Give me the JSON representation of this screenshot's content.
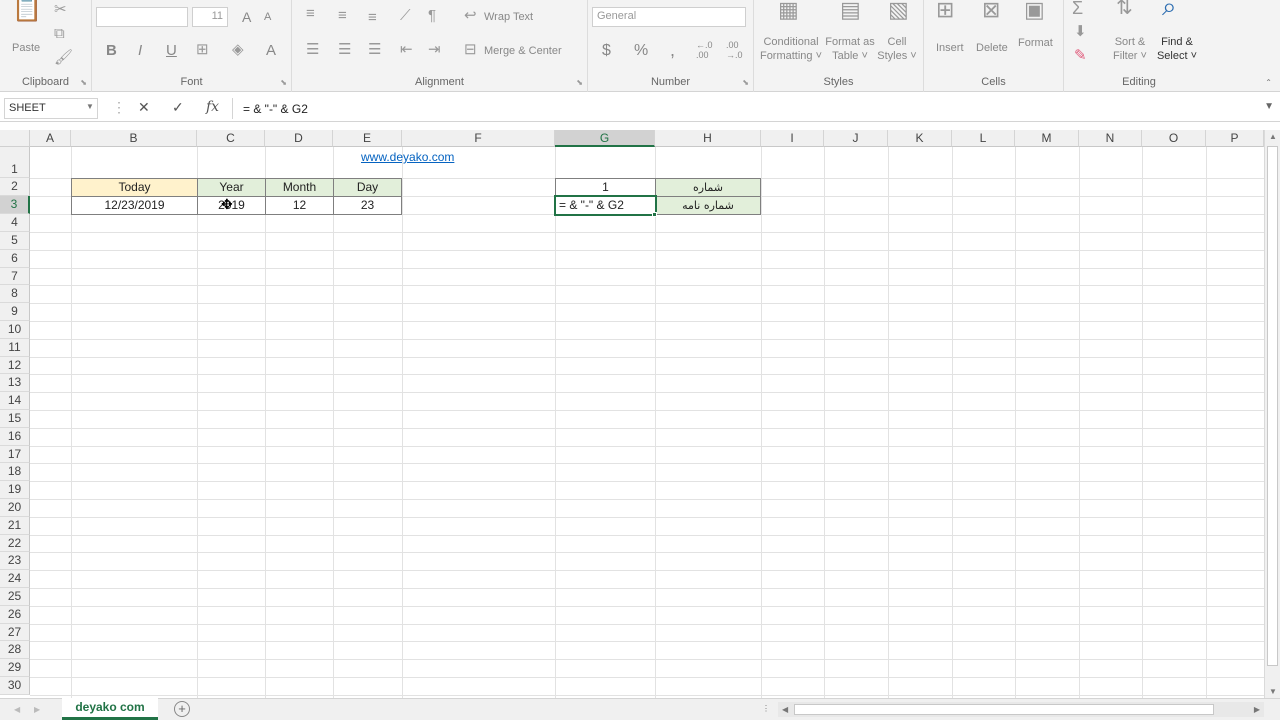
{
  "ribbon": {
    "clipboard": {
      "label": "Clipboard",
      "paste": "Paste"
    },
    "font": {
      "label": "Font",
      "size": "11",
      "bold": "B",
      "italic": "I",
      "underline": "U",
      "font_color": "A",
      "grow": "A",
      "shrink": "A"
    },
    "alignment": {
      "label": "Alignment",
      "wrap_text": "Wrap Text",
      "merge_center": "Merge & Center"
    },
    "number": {
      "label": "Number",
      "format": "General",
      "currency": "$",
      "percent": "%",
      "comma": ",",
      "inc_decimal": "←.0\n.00",
      "dec_decimal": ".00\n→.0"
    },
    "styles": {
      "label": "Styles",
      "conditional": "Conditional\nFormatting ˅",
      "format_table": "Format as\nTable ˅",
      "cell_styles": "Cell\nStyles ˅"
    },
    "cells": {
      "label": "Cells",
      "insert": "Insert",
      "delete": "Delete",
      "format": "Format"
    },
    "editing": {
      "label": "Editing",
      "sort_filter": "Sort &\nFilter ˅",
      "find_select": "Find &\nSelect ˅"
    }
  },
  "formula_bar": {
    "name_box": "SHEET",
    "formula": "= & \"-\" & G2",
    "cancel": "✕",
    "enter": "✓",
    "fx": "fx"
  },
  "columns": [
    "A",
    "B",
    "C",
    "D",
    "E",
    "F",
    "G",
    "H",
    "I",
    "J",
    "K",
    "L",
    "M",
    "N",
    "O",
    "P"
  ],
  "rows": [
    "1",
    "2",
    "3",
    "4",
    "5",
    "6",
    "7",
    "8",
    "9",
    "10",
    "11",
    "12",
    "13",
    "14",
    "15",
    "16",
    "17",
    "18",
    "19",
    "20",
    "21",
    "22",
    "23",
    "24",
    "25",
    "26",
    "27",
    "28",
    "29",
    "30"
  ],
  "cells": {
    "link": "www.deyako.com",
    "b2": "Today",
    "c2": "Year",
    "d2": "Month",
    "e2": "Day",
    "b3": "12/23/2019",
    "c3": "2019",
    "d3": "12",
    "e3": "23",
    "g2": "1",
    "h2": "شماره",
    "g3": "= & \"-\" & G2",
    "h3": "شماره نامه"
  },
  "sheets": {
    "active": "deyako com",
    "add": "+"
  },
  "colors": {
    "accent": "#217346",
    "yellow": "#fff2cc",
    "green": "#e2efda",
    "link": "#0563c1"
  }
}
